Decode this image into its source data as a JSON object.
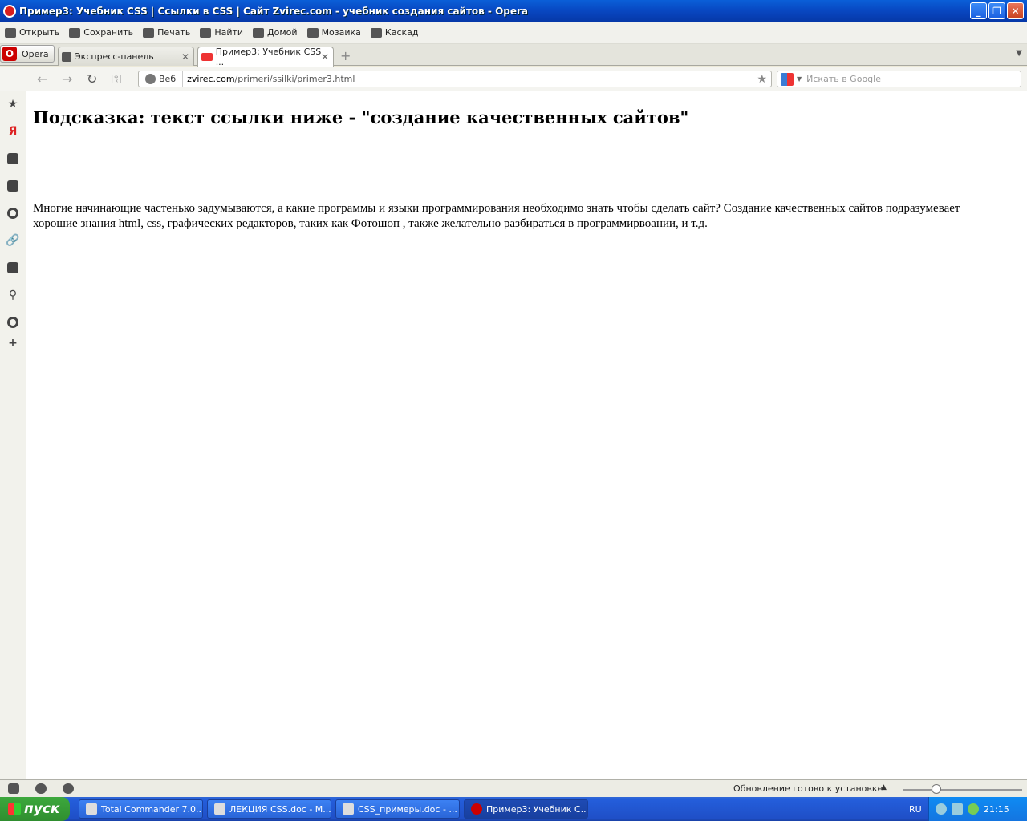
{
  "window": {
    "title": "Пример3: Учебник CSS | Ссылки в CSS | Сайт Zvirec.com - учебник создания сайтов - Opera"
  },
  "toolbar": {
    "items": [
      {
        "label": "Открыть",
        "icon": "folder-icon"
      },
      {
        "label": "Сохранить",
        "icon": "save-icon"
      },
      {
        "label": "Печать",
        "icon": "print-icon"
      },
      {
        "label": "Найти",
        "icon": "search-icon"
      },
      {
        "label": "Домой",
        "icon": "home-icon"
      },
      {
        "label": "Мозаика",
        "icon": "tile-icon"
      },
      {
        "label": "Каскад",
        "icon": "cascade-icon"
      }
    ]
  },
  "tabs": {
    "opera_label": "Opera",
    "items": [
      {
        "label": "Экспресс-панель",
        "active": false
      },
      {
        "label": "Пример3: Учебник CSS ...",
        "active": true
      }
    ]
  },
  "address": {
    "web_label": "Веб",
    "url_host": "zvirec.com",
    "url_path": "/primeri/ssilki/primer3.html",
    "search_placeholder": "Искать в Google"
  },
  "page": {
    "heading": "Подсказка: текст ссылки ниже - \"создание качественных сайтов\"",
    "paragraph": "Многие начинающие частенько задумываются, а какие программы и языки программирования необходимо знать чтобы сделать сайт? Создание качественных сайтов подразумевает хорошие знания html, css, графических редакторов, таких как Фотошоп , также желательно разбираться в программирвоании, и т.д."
  },
  "statusbar": {
    "update_text": "Обновление готово к установке"
  },
  "taskbar": {
    "start_label": "пуск",
    "tasks": [
      {
        "label": "Total Commander 7.0...",
        "active": false
      },
      {
        "label": "ЛЕКЦИЯ CSS.doc - M...",
        "active": false
      },
      {
        "label": "CSS_примеры.doc - ...",
        "active": false
      },
      {
        "label": "Пример3: Учебник С...",
        "active": true
      }
    ],
    "language": "RU",
    "clock": "21:15"
  },
  "colors": {
    "titlebar": "#0847c1",
    "taskbar": "#245edb",
    "start_button": "#3da83d"
  }
}
